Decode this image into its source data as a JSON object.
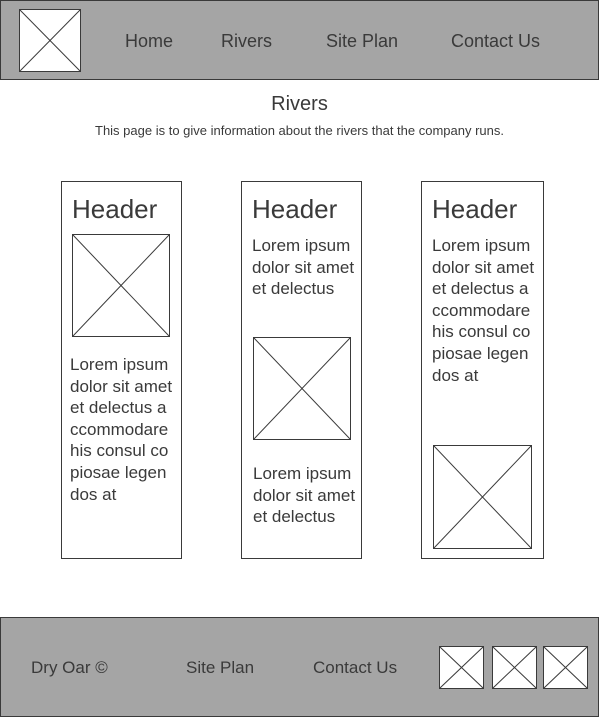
{
  "nav": {
    "items": [
      {
        "label": "Home"
      },
      {
        "label": "Rivers"
      },
      {
        "label": "Site Plan"
      },
      {
        "label": "Contact Us"
      }
    ]
  },
  "main": {
    "title": "Rivers",
    "subtitle": "This page is to give information about the rivers that the company runs."
  },
  "cards": [
    {
      "header": "Header",
      "text": "Lorem ipsum dolor sit amet et delectus accommodare his consul copiosae legendos at"
    },
    {
      "header": "Header",
      "text_top": "Lorem ipsum dolor sit amet et delectus",
      "text_bottom": "Lorem ipsum dolor sit amet et delectus"
    },
    {
      "header": "Header",
      "text": "Lorem ipsum dolor sit amet et delectus accommodare his consul copiosae legendos at"
    }
  ],
  "footer": {
    "copyright": "Dry Oar ©",
    "links": [
      {
        "label": "Site Plan"
      },
      {
        "label": "Contact Us"
      }
    ],
    "social_icons": [
      "image-placeholder-icon",
      "image-placeholder-icon",
      "image-placeholder-icon"
    ]
  },
  "colors": {
    "bar_background": "#a5a5a5",
    "stroke": "#3a3a3a",
    "page_background": "#ffffff"
  }
}
